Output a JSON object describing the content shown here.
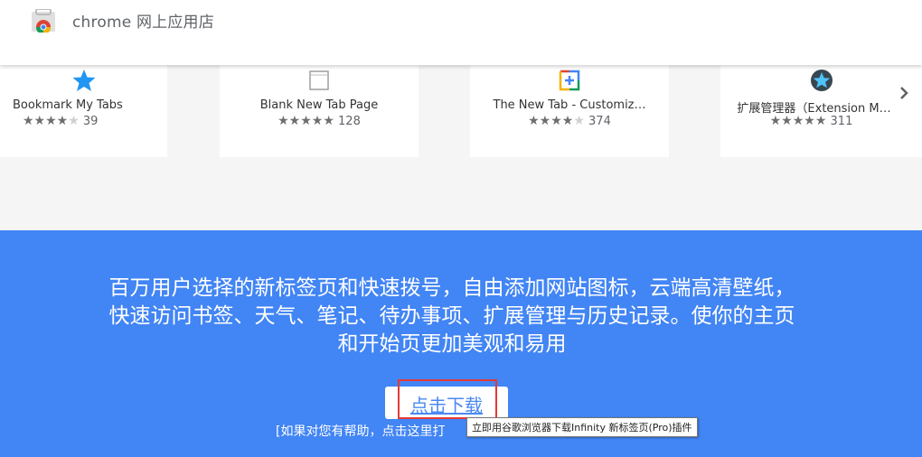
{
  "header": {
    "title": "chrome 网上应用店",
    "logo_icon": "chrome-web-store-icon"
  },
  "extensions": [
    {
      "name": "Bookmark My Tabs",
      "rating_count": "39",
      "stars": 4,
      "icon": "blue-star-icon"
    },
    {
      "name": "Blank New Tab Page",
      "rating_count": "128",
      "stars": 5,
      "icon": "blank-page-icon"
    },
    {
      "name": "The New Tab - Customiz…",
      "rating_count": "374",
      "stars": 4,
      "icon": "google-plus-tile-icon"
    },
    {
      "name": "扩展管理器（Extension M…",
      "rating_count": "311",
      "stars": 5,
      "icon": "star-badge-icon"
    }
  ],
  "carousel": {
    "next_icon": "chevron-right-icon"
  },
  "promo": {
    "text": "百万用户选择的新标签页和快速拨号，自由添加网站图标，云端高清壁纸，快速访问书签、天气、笔记、待办事项、扩展管理与历史记录。使你的主页和开始页更加美观和易用",
    "download_label": "点击下载",
    "help_text": "[如果对您有帮助，点击这里打",
    "tooltip": "立即用谷歌浏览器下载Infinity 新标签页(Pro)插件"
  },
  "colors": {
    "promo_bg": "#4285f4",
    "band_bg": "#f5f5f5",
    "highlight": "#e53935",
    "link": "#4a89f3"
  }
}
